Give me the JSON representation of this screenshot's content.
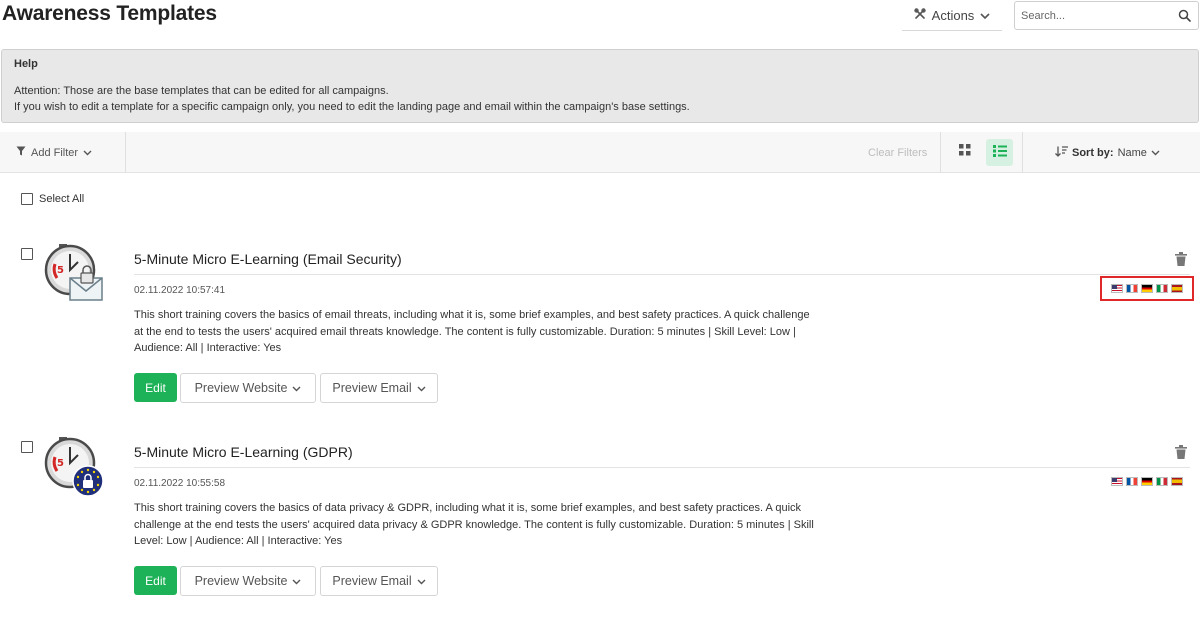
{
  "header": {
    "title": "Awareness Templates",
    "actions_label": "Actions",
    "search_placeholder": "Search..."
  },
  "help": {
    "title": "Help",
    "lines": [
      "Attention: Those are the base templates that can be edited for all campaigns.",
      "If you wish to edit a template for a specific campaign only, you need to edit the landing page and email within the campaign's base settings."
    ]
  },
  "toolbar": {
    "add_filter_label": "Add Filter",
    "clear_filters_label": "Clear Filters",
    "sort_by_label": "Sort by:",
    "sort_value": "Name",
    "active_view": "list"
  },
  "select_all_label": "Select All",
  "templates": [
    {
      "title": "5-Minute Micro E-Learning (Email Security)",
      "date": "02.11.2022 10:57:41",
      "description": "This short training covers the basics of email threats, including what it is, some brief examples, and best safety practices. A quick challenge at the end to tests the users' acquired email threats knowledge. The content is fully customizable. Duration: 5 minutes | Skill Level: Low | Audience: All | Interactive: Yes",
      "edit_label": "Edit",
      "preview_website_label": "Preview Website",
      "preview_email_label": "Preview Email",
      "thumb_icon": "stopwatch-email-lock-icon",
      "flags_highlighted": true,
      "languages": [
        "en-us",
        "fr",
        "de",
        "it",
        "es"
      ]
    },
    {
      "title": "5-Minute Micro E-Learning (GDPR)",
      "date": "02.11.2022 10:55:58",
      "description": "This short training covers the basics of data privacy & GDPR, including what it is, some brief examples, and best safety practices. A quick challenge at the end tests the users' acquired data privacy & GDPR knowledge. The content is fully customizable. Duration: 5 minutes | Skill Level: Low | Audience: All | Interactive: Yes",
      "edit_label": "Edit",
      "preview_website_label": "Preview Website",
      "preview_email_label": "Preview Email",
      "thumb_icon": "stopwatch-eu-lock-icon",
      "flags_highlighted": false,
      "languages": [
        "en-us",
        "fr",
        "de",
        "it",
        "es"
      ]
    }
  ],
  "colors": {
    "accent_green": "#1db257",
    "help_bg": "#e8e8e8",
    "highlight_red": "#e02828",
    "active_view_bg": "#d6f0e1"
  }
}
